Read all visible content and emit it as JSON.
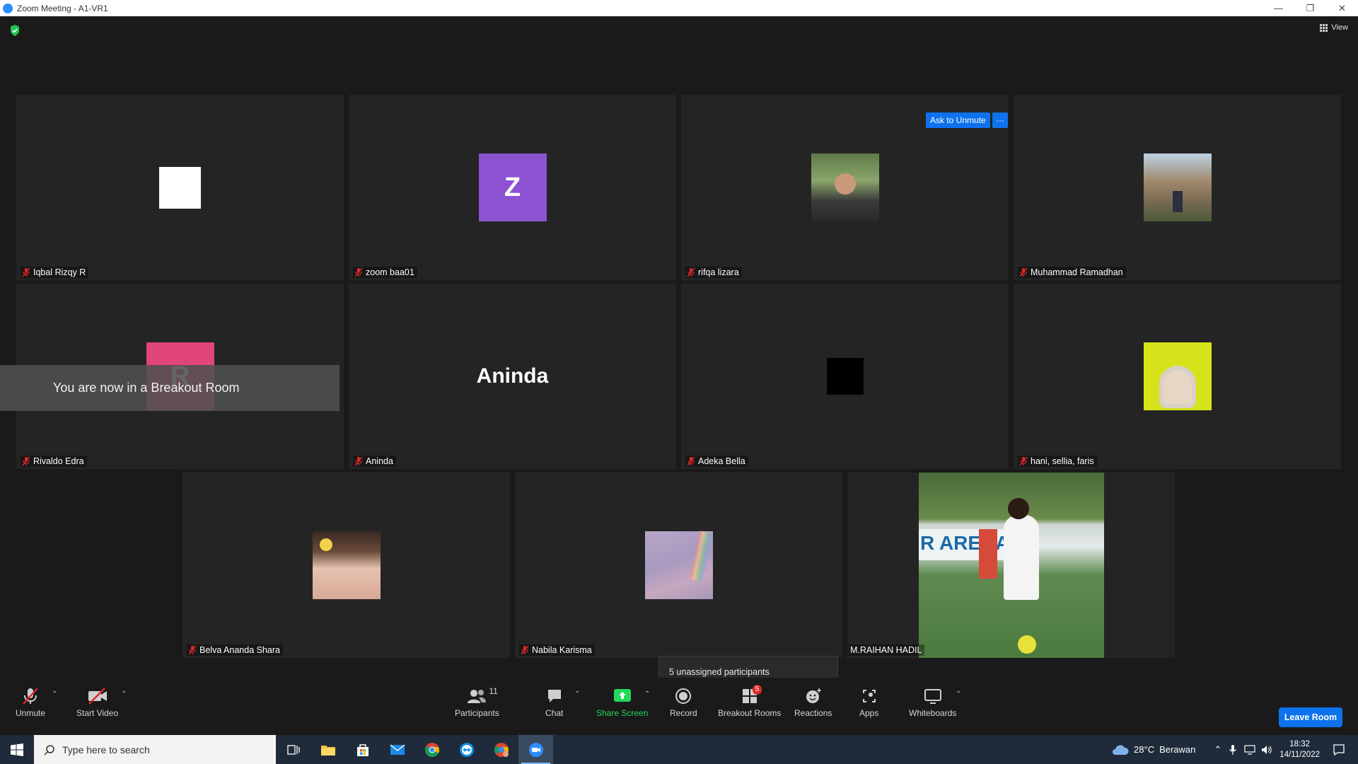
{
  "window": {
    "title": "Zoom Meeting - A1-VR1",
    "controls": [
      "minimize",
      "restore",
      "close"
    ]
  },
  "meeting": {
    "view_label": "View",
    "toast": "You are now in a Breakout Room",
    "ask_to_unmute": "Ask to Unmute",
    "more_label": "···",
    "unassigned_tooltip": "5 unassigned participants"
  },
  "participants": [
    {
      "name": "Iqbal Rizqy R",
      "avatar_type": "white-square"
    },
    {
      "name": "zoom baa01",
      "avatar_type": "letter",
      "letter": "Z",
      "color": "#8c52d1"
    },
    {
      "name": "rifqa lizara",
      "avatar_type": "photo"
    },
    {
      "name": "Muhammad Ramadhan",
      "avatar_type": "photo"
    },
    {
      "name": "Rivaldo Edra",
      "avatar_type": "letter",
      "letter": "R",
      "color": "#e0457b"
    },
    {
      "name": "Aninda",
      "avatar_type": "name-text",
      "display_text": "Aninda"
    },
    {
      "name": "Adeka Bella",
      "avatar_type": "black-square"
    },
    {
      "name": "hani, sellia, faris",
      "avatar_type": "photo"
    },
    {
      "name": "Belva Ananda Shara",
      "avatar_type": "photo"
    },
    {
      "name": "Nabila Karisma",
      "avatar_type": "photo"
    },
    {
      "name": "M.RAIHAN HADIL",
      "avatar_type": "video",
      "video_text": "R ARENA"
    }
  ],
  "toolbar": {
    "unmute": "Unmute",
    "start_video": "Start Video",
    "participants": "Participants",
    "participants_count": "11",
    "chat": "Chat",
    "share_screen": "Share Screen",
    "record": "Record",
    "breakout_rooms": "Breakout Rooms",
    "breakout_badge": "5",
    "reactions": "Reactions",
    "apps": "Apps",
    "whiteboards": "Whiteboards",
    "leave_room": "Leave Room"
  },
  "taskbar": {
    "search_placeholder": "Type here to search",
    "weather_temp": "28°C",
    "weather_desc": "Berawan",
    "time": "18:32",
    "date": "14/11/2022"
  },
  "colors": {
    "accent_blue": "#0e72ed",
    "share_green": "#23d959",
    "mic_off_red": "#e02828"
  }
}
